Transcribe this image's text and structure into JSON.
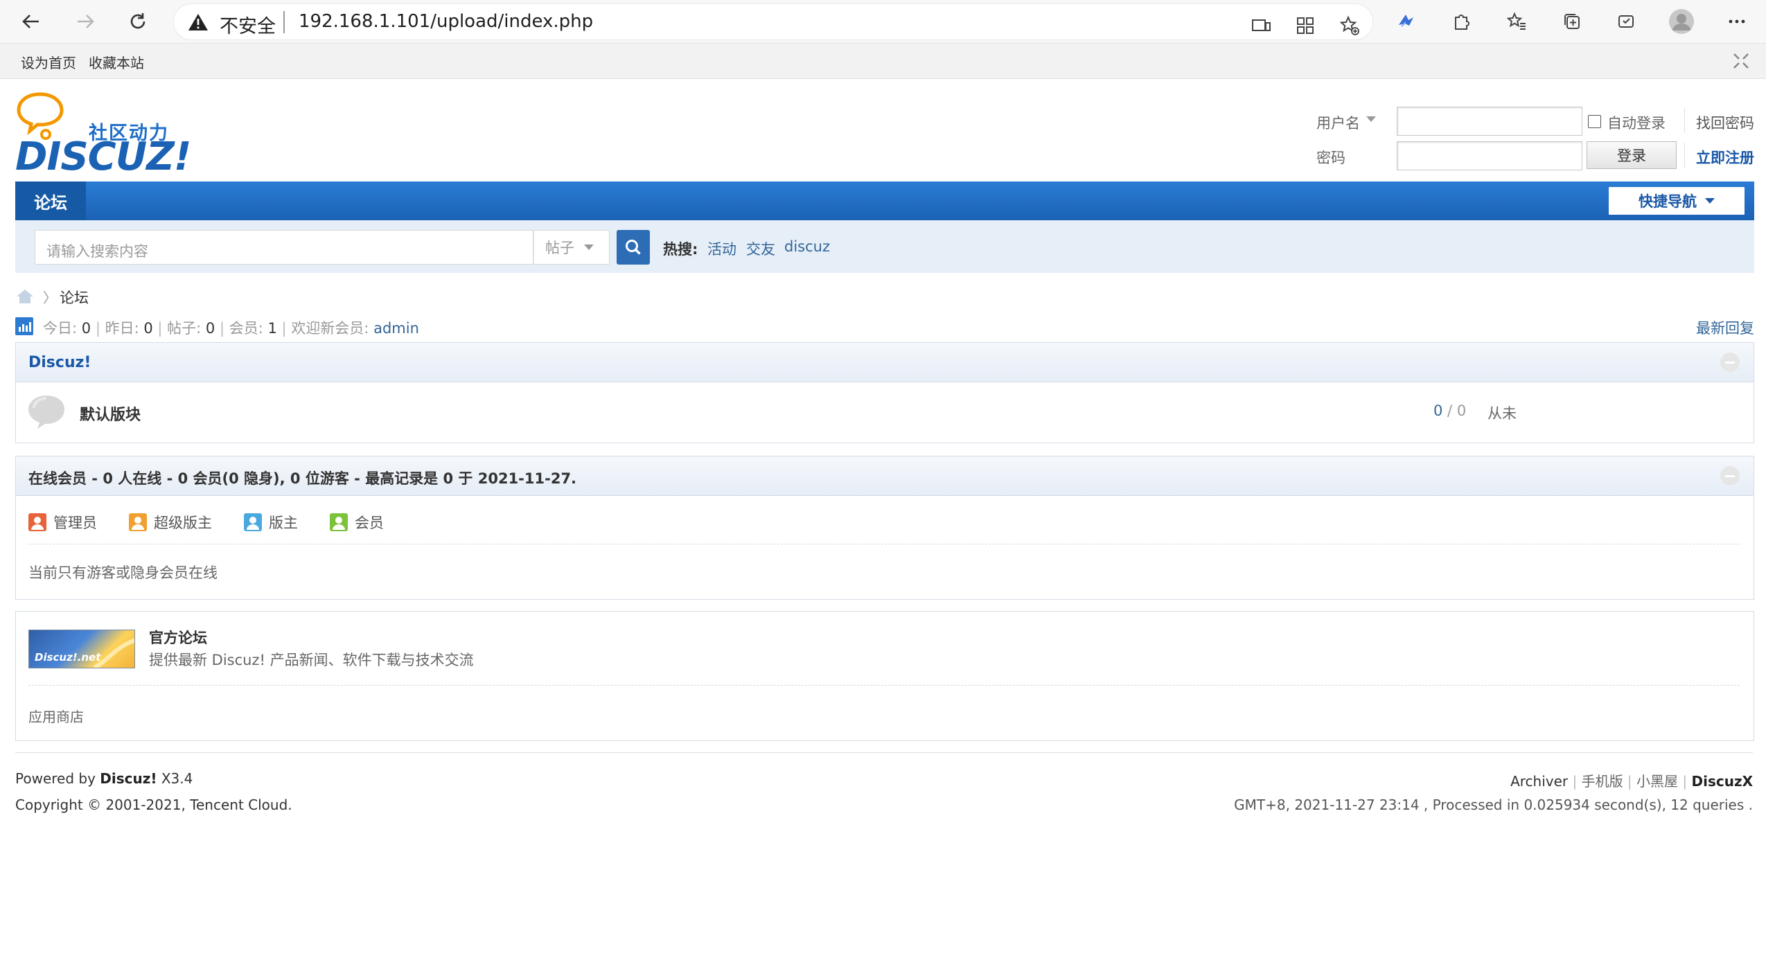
{
  "browser": {
    "security_label": "不安全",
    "url": "192.168.1.101/upload/index.php"
  },
  "topbar": {
    "set_home": "设为首页",
    "bookmark": "收藏本站"
  },
  "logo": {
    "tagline": "社区动力",
    "wordmark": "DISCUZ!"
  },
  "login": {
    "username_label": "用户名",
    "password_label": "密码",
    "auto_login": "自动登录",
    "forgot_password": "找回密码",
    "login_button": "登录",
    "register": "立即注册"
  },
  "nav": {
    "forum": "论坛",
    "quick_nav": "快捷导航"
  },
  "search": {
    "placeholder": "请输入搜索内容",
    "type": "帖子",
    "hot_label": "热搜:",
    "hot_terms": [
      "活动",
      "交友",
      "discuz"
    ]
  },
  "breadcrumb": {
    "current": "论坛"
  },
  "stats": {
    "today_label": "今日:",
    "today": "0",
    "yesterday_label": "昨日:",
    "yesterday": "0",
    "posts_label": "帖子:",
    "posts": "0",
    "members_label": "会员:",
    "members": "1",
    "welcome_label": "欢迎新会员:",
    "newest_member": "admin",
    "latest_replies": "最新回复"
  },
  "category": {
    "title": "Discuz!",
    "forum_name": "默认版块",
    "threads": "0",
    "slash": " / ",
    "posts": "0",
    "last_post": "从未"
  },
  "online": {
    "header": "在线会员 - 0 人在线 - 0 会员(0 隐身), 0 位游客 - 最高记录是 0 于 2021-11-27.",
    "roles": [
      "管理员",
      "超级版主",
      "版主",
      "会员"
    ],
    "role_colors": [
      "#e8623a",
      "#f0a030",
      "#4aa8e0",
      "#7cc23a"
    ],
    "empty_text": "当前只有游客或隐身会员在线"
  },
  "links": {
    "banner_text": "Discuz!.net",
    "official_title": "官方论坛",
    "official_desc": "提供最新 Discuz! 产品新闻、软件下载与技术交流",
    "app_store": "应用商店"
  },
  "footer": {
    "powered_prefix": "Powered by ",
    "powered_brand": "Discuz!",
    "version": " X3.4",
    "copyright": "Copyright © 2001-2021, Tencent Cloud.",
    "links": [
      "Archiver",
      "手机版",
      "小黑屋"
    ],
    "brand_right": "DiscuzX",
    "stats_line": "GMT+8, 2021-11-27 23:14 , Processed in 0.025934 second(s), 12 queries ."
  },
  "colors": {
    "nav_blue": "#1b62b4",
    "link_blue": "#336699",
    "search_bg": "#e6eef7"
  }
}
